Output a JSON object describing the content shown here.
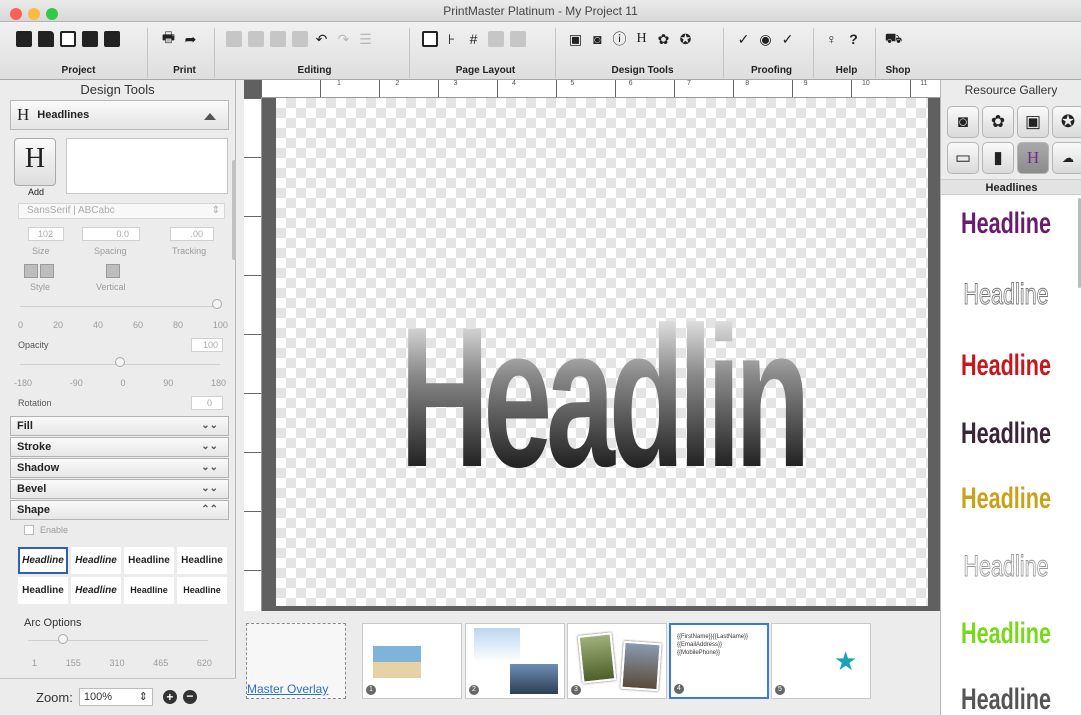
{
  "window": {
    "title": "PrintMaster Platinum - My Project 11"
  },
  "toolbar": {
    "groups": [
      {
        "label": "Project"
      },
      {
        "label": "Print"
      },
      {
        "label": "Editing"
      },
      {
        "label": "Page Layout"
      },
      {
        "label": "Design Tools"
      },
      {
        "label": "Proofing"
      },
      {
        "label": "Help"
      },
      {
        "label": "Shop"
      }
    ]
  },
  "left_panel": {
    "title": "Design Tools",
    "section_title": "Headlines",
    "add_label": "Add",
    "font_value": "SansSerif | ABCabc",
    "size_value": "102",
    "size_label": "Size",
    "spacing_value": "0.0",
    "spacing_label": "Spacing",
    "tracking_value": ".00",
    "tracking_label": "Tracking",
    "style_label": "Style",
    "vertical_label": "Vertical",
    "opacity_ticks": [
      "0",
      "20",
      "40",
      "60",
      "80",
      "100"
    ],
    "opacity_label": "Opacity",
    "opacity_value": "100",
    "rotation_ticks": [
      "-180",
      "-90",
      "0",
      "90",
      "180"
    ],
    "rotation_label": "Rotation",
    "rotation_value": "0",
    "sections": [
      "Fill",
      "Stroke",
      "Shadow",
      "Bevel",
      "Shape"
    ],
    "enable_label": "Enable",
    "shape_samples": [
      "Headline",
      "Headline",
      "Headline",
      "Headline",
      "Headline",
      "Headline",
      "Headline",
      "Headline"
    ],
    "arc_label": "Arc Options",
    "arc_ticks": [
      "1",
      "155",
      "310",
      "465",
      "620"
    ]
  },
  "zoom": {
    "label": "Zoom:",
    "value": "100%"
  },
  "canvas": {
    "headline_text": "Headline"
  },
  "ruler": {
    "marks": [
      "1",
      "2",
      "3",
      "4",
      "5",
      "6",
      "7",
      "8",
      "9",
      "10",
      "11"
    ]
  },
  "right_panel": {
    "title": "Resource Gallery",
    "subtitle": "Headlines",
    "samples": [
      {
        "text": "Headline",
        "color": "#6a1b6e"
      },
      {
        "text": "Headline",
        "color": "#ffffff"
      },
      {
        "text": "Headline",
        "color": "#c8161b"
      },
      {
        "text": "Headline",
        "color": "#3a2438"
      },
      {
        "text": "Headline",
        "color": "#c9a21a"
      },
      {
        "text": "Headline",
        "color": "#ffffff"
      },
      {
        "text": "Headline",
        "color": "#7ad81a"
      },
      {
        "text": "Headline",
        "color": "#555555"
      }
    ]
  },
  "thumbnails": {
    "master_overlay": "Master Overlay",
    "items": [
      {
        "num": "1"
      },
      {
        "num": "2"
      },
      {
        "num": "3"
      },
      {
        "num": "4",
        "text": "{{FirstName}}{{LastName}}\n{{EmailAddress}}\n{{MobilePhone}}"
      },
      {
        "num": "5"
      }
    ]
  }
}
